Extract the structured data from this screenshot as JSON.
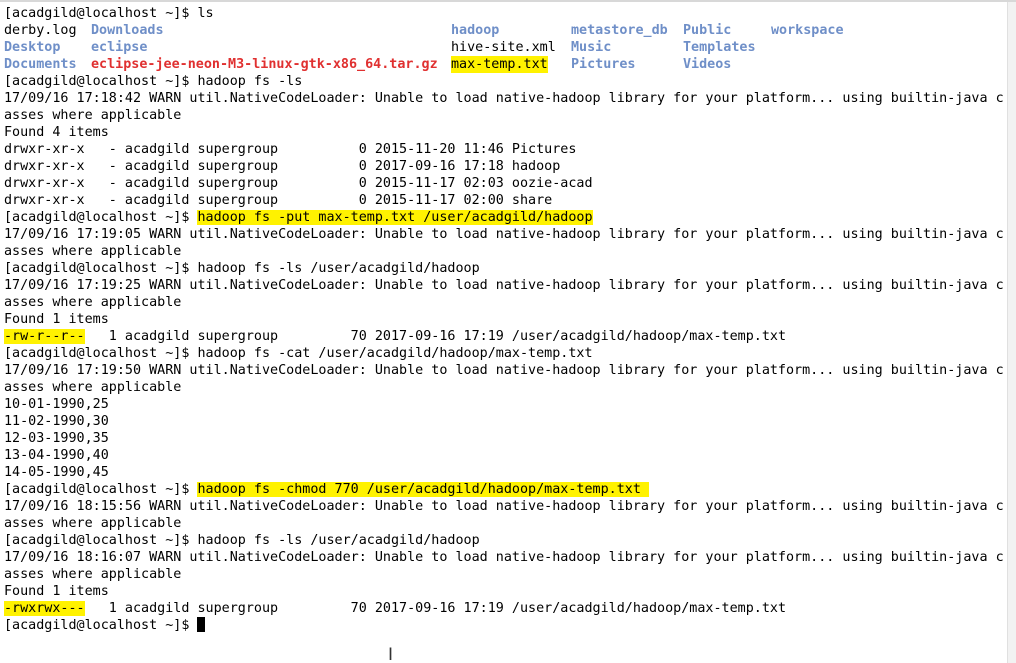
{
  "prompt": "[acadgild@localhost ~]$ ",
  "ls_command": "[acadgild@localhost ~]$ ls",
  "ls_listing": [
    [
      {
        "text": "derby.log",
        "kind": "file"
      },
      {
        "text": "Downloads",
        "kind": "dir"
      },
      {
        "text": "hadoop",
        "kind": "dir"
      },
      {
        "text": "metastore_db",
        "kind": "dir"
      },
      {
        "text": "Public",
        "kind": "dir"
      },
      {
        "text": "workspace",
        "kind": "dir"
      }
    ],
    [
      {
        "text": "Desktop",
        "kind": "dir"
      },
      {
        "text": "eclipse",
        "kind": "dir"
      },
      {
        "text": "hive-site.xml",
        "kind": "file"
      },
      {
        "text": "Music",
        "kind": "dir"
      },
      {
        "text": "Templates",
        "kind": "dir"
      },
      {
        "text": "",
        "kind": "file"
      }
    ],
    [
      {
        "text": "Documents",
        "kind": "dir"
      },
      {
        "text": "eclipse-jee-neon-M3-linux-gtk-x86_64.tar.gz",
        "kind": "archive"
      },
      {
        "text": "max-temp.txt",
        "kind": "highlighted"
      },
      {
        "text": "Pictures",
        "kind": "dir"
      },
      {
        "text": "Videos",
        "kind": "dir"
      },
      {
        "text": "",
        "kind": "file"
      }
    ]
  ],
  "highlight_color": "#fff200",
  "dir_color": "#6f8fc8",
  "archive_color": "#e03030",
  "lines": [
    {
      "text": "[acadgild@localhost ~]$ hadoop fs -ls"
    },
    {
      "text": "17/09/16 17:18:42 WARN util.NativeCodeLoader: Unable to load native-hadoop library for your platform... using builtin-java cl"
    },
    {
      "text": "asses where applicable"
    },
    {
      "text": "Found 4 items"
    },
    {
      "text": "drwxr-xr-x   - acadgild supergroup          0 2015-11-20 11:46 Pictures"
    },
    {
      "text": "drwxr-xr-x   - acadgild supergroup          0 2017-09-16 17:18 hadoop"
    },
    {
      "text": "drwxr-xr-x   - acadgild supergroup          0 2015-11-17 02:03 oozie-acad"
    },
    {
      "text": "drwxr-xr-x   - acadgild supergroup          0 2015-11-17 02:00 share"
    },
    {
      "pre": "[acadgild@localhost ~]$ ",
      "hl": "hadoop fs -put max-temp.txt /user/acadgild/hadoop",
      "post": ""
    },
    {
      "text": "17/09/16 17:19:05 WARN util.NativeCodeLoader: Unable to load native-hadoop library for your platform... using builtin-java cl"
    },
    {
      "text": "asses where applicable"
    },
    {
      "text": "[acadgild@localhost ~]$ hadoop fs -ls /user/acadgild/hadoop"
    },
    {
      "text": "17/09/16 17:19:25 WARN util.NativeCodeLoader: Unable to load native-hadoop library for your platform... using builtin-java cl"
    },
    {
      "text": "asses where applicable"
    },
    {
      "text": "Found 1 items"
    },
    {
      "pre": "",
      "hl": "-rw-r--r--",
      "post": "   1 acadgild supergroup         70 2017-09-16 17:19 /user/acadgild/hadoop/max-temp.txt"
    },
    {
      "text": "[acadgild@localhost ~]$ hadoop fs -cat /user/acadgild/hadoop/max-temp.txt"
    },
    {
      "text": "17/09/16 17:19:50 WARN util.NativeCodeLoader: Unable to load native-hadoop library for your platform... using builtin-java cl"
    },
    {
      "text": "asses where applicable"
    },
    {
      "text": "10-01-1990,25"
    },
    {
      "text": "11-02-1990,30"
    },
    {
      "text": "12-03-1990,35"
    },
    {
      "text": "13-04-1990,40"
    },
    {
      "text": "14-05-1990,45"
    },
    {
      "pre": "[acadgild@localhost ~]$ ",
      "hl": "hadoop fs -chmod 770 /user/acadgild/hadoop/max-temp.txt ",
      "post": ""
    },
    {
      "text": "17/09/16 18:15:56 WARN util.NativeCodeLoader: Unable to load native-hadoop library for your platform... using builtin-java cl"
    },
    {
      "text": "asses where applicable"
    },
    {
      "text": "[acadgild@localhost ~]$ hadoop fs -ls /user/acadgild/hadoop"
    },
    {
      "text": "17/09/16 18:16:07 WARN util.NativeCodeLoader: Unable to load native-hadoop library for your platform... using builtin-java cl"
    },
    {
      "text": "asses where applicable"
    },
    {
      "text": "Found 1 items"
    },
    {
      "pre": "",
      "hl": "-rwxrwx---",
      "post": "   1 acadgild supergroup         70 2017-09-16 17:19 /user/acadgild/hadoop/max-temp.txt"
    }
  ],
  "icons": {
    "cursor": "block-cursor-icon",
    "mouse": "text-ibeam-icon"
  },
  "ibeam_glyph": "I"
}
